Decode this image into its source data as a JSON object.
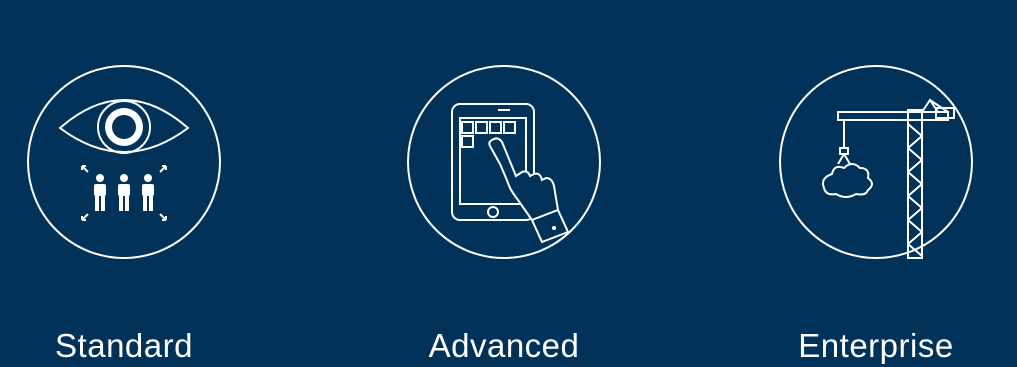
{
  "colors": {
    "background": "#00325a",
    "foreground": "#ffffff"
  },
  "tiers": [
    {
      "label": "Standard",
      "icon": "eye-people-icon"
    },
    {
      "label": "Advanced",
      "icon": "tablet-touch-icon"
    },
    {
      "label": "Enterprise",
      "icon": "crane-cloud-icon"
    }
  ]
}
